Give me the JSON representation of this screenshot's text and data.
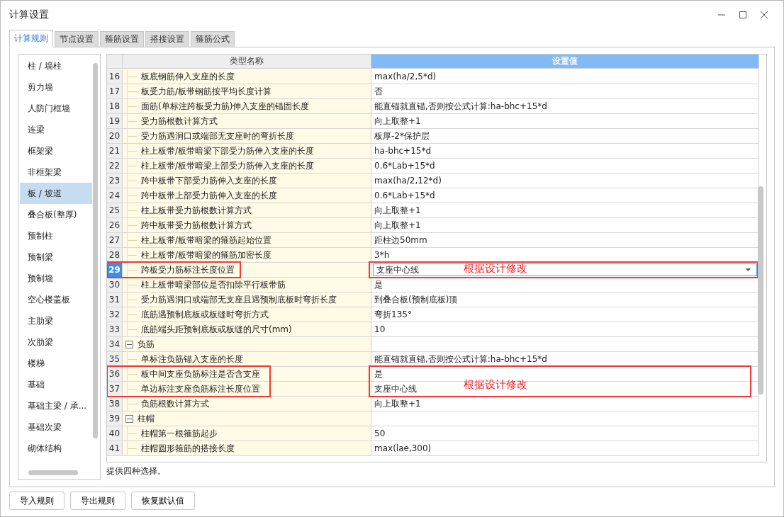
{
  "window": {
    "title": "计算设置"
  },
  "tabs": [
    {
      "label": "计算规则",
      "selected": true
    },
    {
      "label": "节点设置",
      "selected": false
    },
    {
      "label": "箍筋设置",
      "selected": false
    },
    {
      "label": "搭接设置",
      "selected": false
    },
    {
      "label": "箍筋公式",
      "selected": false
    }
  ],
  "sidebar": {
    "items": [
      {
        "label": "柱 / 墙柱",
        "selected": false
      },
      {
        "label": "剪力墙",
        "selected": false
      },
      {
        "label": "人防门框墙",
        "selected": false
      },
      {
        "label": "连梁",
        "selected": false
      },
      {
        "label": "框架梁",
        "selected": false
      },
      {
        "label": "非框架梁",
        "selected": false
      },
      {
        "label": "板 / 坡道",
        "selected": true
      },
      {
        "label": "叠合板(整厚)",
        "selected": false
      },
      {
        "label": "预制柱",
        "selected": false
      },
      {
        "label": "预制梁",
        "selected": false
      },
      {
        "label": "预制墙",
        "selected": false
      },
      {
        "label": "空心楼盖板",
        "selected": false
      },
      {
        "label": "主肋梁",
        "selected": false
      },
      {
        "label": "次肋梁",
        "selected": false
      },
      {
        "label": "楼梯",
        "selected": false
      },
      {
        "label": "基础",
        "selected": false
      },
      {
        "label": "基础主梁 / 承...",
        "selected": false
      },
      {
        "label": "基础次梁",
        "selected": false
      },
      {
        "label": "砌体结构",
        "selected": false
      }
    ]
  },
  "table": {
    "columns": [
      "类型名称",
      "设置值"
    ],
    "rows": [
      {
        "number": "16",
        "kind": "item",
        "name": "板底钢筋伸入支座的长度",
        "value": "max(ha/2,5*d)",
        "selected": false,
        "marked": false
      },
      {
        "number": "17",
        "kind": "item",
        "name": "板受力筋/板带钢筋按平均长度计算",
        "value": "否",
        "selected": false,
        "marked": false
      },
      {
        "number": "18",
        "kind": "item",
        "name": "面筋(单标注跨板受力筋)伸入支座的锚固长度",
        "value": "能直锚就直锚,否则按公式计算:ha-bhc+15*d",
        "selected": false,
        "marked": false
      },
      {
        "number": "19",
        "kind": "item",
        "name": "受力筋根数计算方式",
        "value": "向上取整+1",
        "selected": false,
        "marked": false
      },
      {
        "number": "20",
        "kind": "item",
        "name": "受力筋遇洞口或端部无支座时的弯折长度",
        "value": "板厚-2*保护层",
        "selected": false,
        "marked": false
      },
      {
        "number": "21",
        "kind": "item",
        "name": "柱上板带/板带暗梁下部受力筋伸入支座的长度",
        "value": "ha-bhc+15*d",
        "selected": false,
        "marked": false
      },
      {
        "number": "22",
        "kind": "item",
        "name": "柱上板带/板带暗梁上部受力筋伸入支座的长度",
        "value": "0.6*Lab+15*d",
        "selected": false,
        "marked": false
      },
      {
        "number": "23",
        "kind": "item",
        "name": "跨中板带下部受力筋伸入支座的长度",
        "value": "max(ha/2,12*d)",
        "selected": false,
        "marked": false
      },
      {
        "number": "24",
        "kind": "item",
        "name": "跨中板带上部受力筋伸入支座的长度",
        "value": "0.6*Lab+15*d",
        "selected": false,
        "marked": false
      },
      {
        "number": "25",
        "kind": "item",
        "name": "柱上板带受力筋根数计算方式",
        "value": "向上取整+1",
        "selected": false,
        "marked": false
      },
      {
        "number": "26",
        "kind": "item",
        "name": "跨中板带受力筋根数计算方式",
        "value": "向上取整+1",
        "selected": false,
        "marked": false
      },
      {
        "number": "27",
        "kind": "item",
        "name": "柱上板带/板带暗梁的箍筋起始位置",
        "value": "距柱边50mm",
        "selected": false,
        "marked": false
      },
      {
        "number": "28",
        "kind": "item",
        "name": "柱上板带/板带暗梁的箍筋加密长度",
        "value": "3*h",
        "selected": false,
        "marked": false
      },
      {
        "number": "29",
        "kind": "item",
        "name": "跨板受力筋标注长度位置",
        "value": "支座中心线",
        "selected": true,
        "marked": true,
        "note": "根据设计修改"
      },
      {
        "number": "30",
        "kind": "item",
        "name": "柱上板带暗梁部位是否扣除平行板带筋",
        "value": "是",
        "selected": false,
        "marked": false
      },
      {
        "number": "31",
        "kind": "item",
        "name": "受力筋遇洞口或端部无支座且遇预制底板时弯折长度",
        "value": "到叠合板(预制底板)顶",
        "selected": false,
        "marked": false
      },
      {
        "number": "32",
        "kind": "item",
        "name": "底筋遇预制底板或板缝时弯折方式",
        "value": "弯折135°",
        "selected": false,
        "marked": false
      },
      {
        "number": "33",
        "kind": "item",
        "name": "底筋端头距预制底板或板缝的尺寸(mm)",
        "value": "10",
        "selected": false,
        "marked": false
      },
      {
        "number": "34",
        "kind": "group",
        "name": "负筋",
        "selected": false,
        "marked": false,
        "expanded": true
      },
      {
        "number": "35",
        "kind": "item",
        "name": "单标注负筋锚入支座的长度",
        "value": "能直锚就直锚,否则按公式计算:ha-bhc+15*d",
        "selected": false,
        "marked": false
      },
      {
        "number": "36",
        "kind": "item",
        "name": "板中间支座负筋标注是否含支座",
        "value": "是",
        "selected": false,
        "marked": true
      },
      {
        "number": "37",
        "kind": "item",
        "name": "单边标注支座负筋标注长度位置",
        "value": "支座中心线",
        "selected": false,
        "marked": true,
        "note": "根据设计修改"
      },
      {
        "number": "38",
        "kind": "item",
        "name": "负筋根数计算方式",
        "value": "向上取整+1",
        "selected": false,
        "marked": false
      },
      {
        "number": "39",
        "kind": "group",
        "name": "柱帽",
        "selected": false,
        "marked": false,
        "expanded": true
      },
      {
        "number": "40",
        "kind": "item",
        "name": "柱帽第一根箍筋起步",
        "value": "50",
        "selected": false,
        "marked": false
      },
      {
        "number": "41",
        "kind": "item",
        "name": "柱帽圆形箍筋的搭接长度",
        "value": "max(lae,300)",
        "selected": false,
        "marked": false
      }
    ]
  },
  "hint": "提供四种选择。",
  "buttons": [
    "导入规则",
    "导出规则",
    "恢复默认值"
  ]
}
